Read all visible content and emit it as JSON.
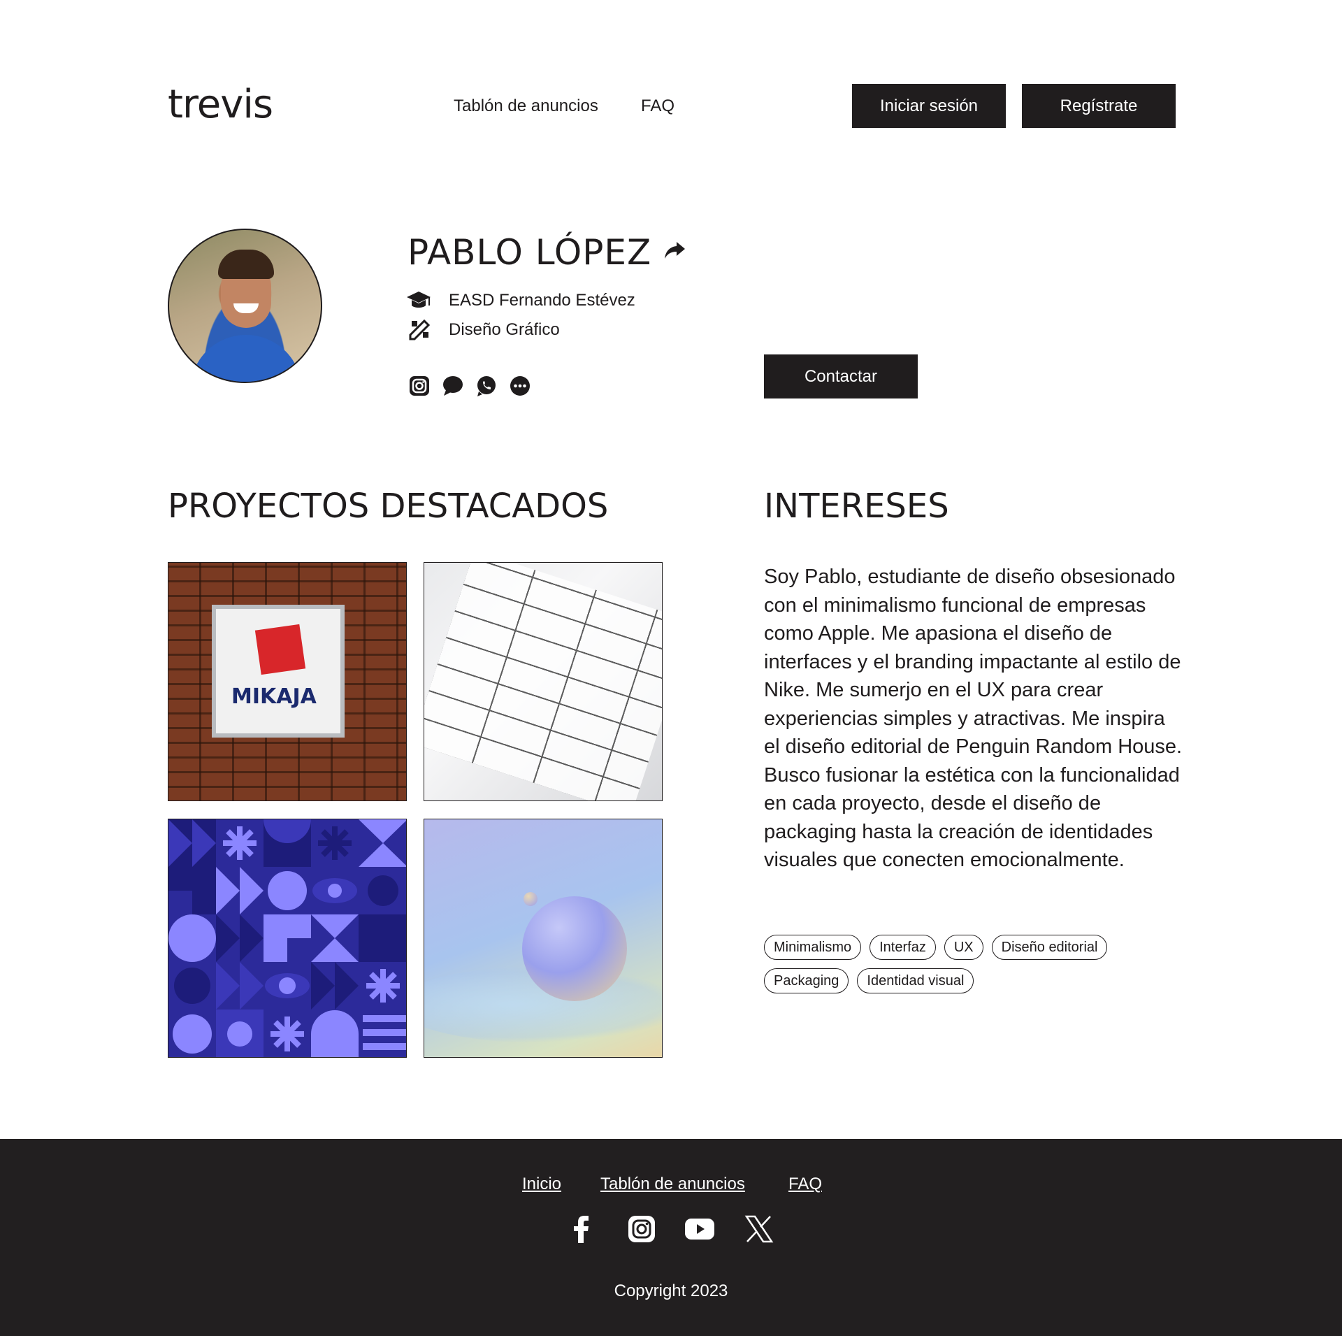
{
  "header": {
    "logo": "trevis",
    "nav": [
      {
        "label": "Tablón de anuncios"
      },
      {
        "label": "FAQ"
      }
    ],
    "login_label": "Iniciar sesión",
    "register_label": "Regístrate"
  },
  "profile": {
    "name": "PABLO LÓPEZ",
    "school": "EASD Fernando Estévez",
    "field": "Diseño Gráfico",
    "icons": {
      "share": "share-icon",
      "school": "graduation-cap-icon",
      "field": "design-tools-icon",
      "social": [
        "instagram-icon",
        "chat-icon",
        "whatsapp-icon",
        "more-icon"
      ]
    },
    "contact_label": "Contactar"
  },
  "projects": {
    "title": "PROYECTOS DESTACADOS",
    "items": [
      {
        "sign_text": "MIKAJA"
      },
      {},
      {},
      {}
    ]
  },
  "interests": {
    "title": "INTERESES",
    "bio": "Soy Pablo, estudiante de diseño obsesionado con el minimalismo funcional de empresas como Apple. Me apasiona el diseño de interfaces y el branding impactante al estilo de Nike. Me sumerjo en el UX para crear experiencias simples y atractivas. Me inspira el diseño editorial de Penguin Random House. Busco fusionar la estética con la funcionalidad en cada proyecto, desde el diseño de packaging hasta la creación de identidades visuales que conecten emocionalmente.",
    "tags": [
      "Minimalismo",
      "Interfaz",
      "UX",
      "Diseño editorial",
      "Packaging",
      "Identidad visual"
    ]
  },
  "footer": {
    "links": [
      "Inicio",
      "Tablón de anuncios",
      "FAQ"
    ],
    "social_icons": [
      "facebook-icon",
      "instagram-icon",
      "youtube-icon",
      "x-icon"
    ],
    "copyright": "Copyright 2023"
  },
  "colors": {
    "dark": "#201d1e",
    "text": "#1f1c1d",
    "background": "#ffffff"
  }
}
